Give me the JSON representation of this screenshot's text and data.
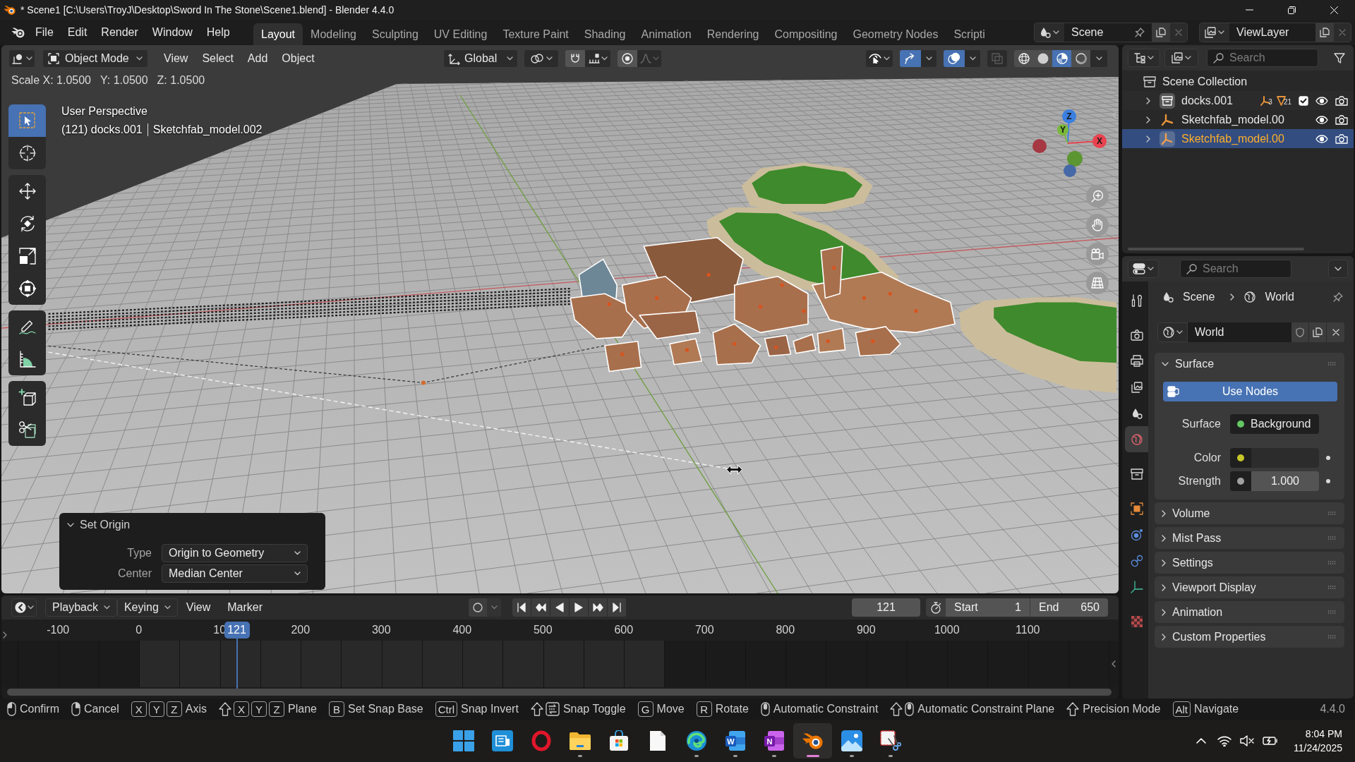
{
  "window": {
    "title": "* Scene1 [C:\\Users\\TroyJ\\Desktop\\Sword In The Stone\\Scene1.blend] - Blender 4.4.0"
  },
  "menu": [
    "File",
    "Edit",
    "Render",
    "Window",
    "Help"
  ],
  "workspaces": [
    {
      "label": "Layout",
      "selected": true
    },
    {
      "label": "Modeling",
      "selected": false
    },
    {
      "label": "Sculpting",
      "selected": false
    },
    {
      "label": "UV Editing",
      "selected": false
    },
    {
      "label": "Texture Paint",
      "selected": false
    },
    {
      "label": "Shading",
      "selected": false
    },
    {
      "label": "Animation",
      "selected": false
    },
    {
      "label": "Rendering",
      "selected": false
    },
    {
      "label": "Compositing",
      "selected": false
    },
    {
      "label": "Geometry Nodes",
      "selected": false
    },
    {
      "label": "Scripti",
      "selected": false
    }
  ],
  "scene_selector": {
    "value": "Scene"
  },
  "view_layer_selector": {
    "value": "ViewLayer"
  },
  "viewport": {
    "header": {
      "mode": "Object Mode",
      "menus": [
        "View",
        "Select",
        "Add",
        "Object"
      ],
      "orientation": "Global",
      "toggles": [
        {
          "kind": "gizmos",
          "on": true
        },
        {
          "kind": "overlays",
          "on": true
        },
        {
          "kind": "xray",
          "on": false
        }
      ],
      "shading": [
        {
          "kind": "wireframe",
          "selected": false
        },
        {
          "kind": "solid",
          "selected": false
        },
        {
          "kind": "material",
          "selected": true
        },
        {
          "kind": "rendered",
          "selected": false
        }
      ]
    },
    "readout": [
      "Scale X: 1.0500",
      "Y: 1.0500",
      "Z: 1.0500"
    ],
    "tool_groups": [
      [
        {
          "kind": "select_box",
          "selected": true
        },
        {
          "kind": "cursor",
          "selected": false
        }
      ],
      [
        {
          "kind": "move",
          "selected": false
        },
        {
          "kind": "rotate",
          "selected": false
        },
        {
          "kind": "scale",
          "selected": false
        },
        {
          "kind": "transform",
          "selected": false
        }
      ],
      [
        {
          "kind": "annotate",
          "selected": false
        },
        {
          "kind": "measure",
          "selected": false
        }
      ],
      [
        {
          "kind": "add_cube",
          "selected": false
        },
        {
          "kind": "cut",
          "selected": false
        }
      ]
    ],
    "view_name": "User Perspective",
    "object_info": [
      "(121) docks.001",
      "Sketchfab_model.002"
    ],
    "gizmo_axes": [
      {
        "label": "Z",
        "color": "#3b7fe0"
      },
      {
        "label": "Y",
        "color": "#7ab83a"
      },
      {
        "label": "X",
        "color": "#e8434f"
      }
    ],
    "last_operation": {
      "title": "Set Origin",
      "expanded": true,
      "fields": [
        {
          "label": "Type",
          "value": "Origin to Geometry"
        },
        {
          "label": "Center",
          "value": "Median Center"
        }
      ]
    }
  },
  "outliner": {
    "search": {
      "placeholder": "Search"
    },
    "tree": [
      {
        "label": "Scene Collection",
        "selected": false,
        "children": [
          {
            "kind": "collection",
            "label": "docks.001",
            "expanded": false,
            "selected": false,
            "counts": [
              "3",
              "21"
            ],
            "checked": true
          },
          {
            "kind": "armature",
            "label": "Sketchfab_model.00",
            "expanded": false,
            "selected": false
          },
          {
            "kind": "armature",
            "label": "Sketchfab_model.00",
            "expanded": false,
            "selected": true
          }
        ]
      }
    ]
  },
  "properties": {
    "search": {
      "placeholder": "Search"
    },
    "tab_groups": [
      [
        {
          "kind": "tool",
          "selected": false
        }
      ],
      [
        {
          "kind": "render",
          "selected": false
        },
        {
          "kind": "output",
          "selected": false
        },
        {
          "kind": "view_layer",
          "selected": false
        },
        {
          "kind": "scene",
          "selected": false
        },
        {
          "kind": "world",
          "selected": true
        }
      ],
      [
        {
          "kind": "collection",
          "selected": false
        }
      ],
      [
        {
          "kind": "object",
          "selected": false
        },
        {
          "kind": "physics",
          "selected": false
        },
        {
          "kind": "constraints",
          "selected": false
        },
        {
          "kind": "data",
          "selected": false
        }
      ],
      [
        {
          "kind": "texture",
          "selected": false
        }
      ]
    ],
    "breadcrumb": [
      "Scene",
      "World"
    ],
    "world_name": "World",
    "panels": [
      {
        "title": "Surface",
        "expanded": true,
        "use_nodes": "Use Nodes",
        "rows": [
          {
            "kind": "link",
            "label": "Surface",
            "value": "Background",
            "color": "#63c763"
          },
          {
            "kind": "color",
            "label": "Color",
            "color": "#c7c729"
          },
          {
            "kind": "number",
            "label": "Strength",
            "value": "1.000",
            "color": "#a1a1a1"
          }
        ]
      },
      {
        "title": "Volume",
        "expanded": false
      },
      {
        "title": "Mist Pass",
        "expanded": false
      },
      {
        "title": "Settings",
        "expanded": false
      },
      {
        "title": "Viewport Display",
        "expanded": false
      },
      {
        "title": "Animation",
        "expanded": false
      },
      {
        "title": "Custom Properties",
        "expanded": false
      }
    ]
  },
  "timeline": {
    "menus": [
      {
        "kind": "dropdown",
        "label": "Playback"
      },
      {
        "kind": "dropdown",
        "label": "Keying"
      },
      {
        "kind": "menu",
        "label": "View"
      },
      {
        "kind": "menu",
        "label": "Marker"
      }
    ],
    "auto_keying": false,
    "current_frame": "121",
    "start": {
      "label": "Start",
      "value": "1"
    },
    "end": {
      "label": "End",
      "value": "650"
    },
    "ruler": [
      "-100",
      "0",
      "10",
      "200",
      "300",
      "400",
      "500",
      "600",
      "700",
      "800",
      "900",
      "1000",
      "1100"
    ],
    "playhead": "121"
  },
  "status_bar": {
    "hints": [
      {
        "keys": [
          {
            "kind": "mouse_left"
          }
        ],
        "label": "Confirm"
      },
      {
        "keys": [
          {
            "kind": "mouse_right"
          }
        ],
        "label": "Cancel"
      },
      {
        "keys": [
          {
            "kind": "key",
            "label": "X"
          },
          {
            "kind": "key",
            "label": "Y"
          },
          {
            "kind": "key",
            "label": "Z"
          }
        ],
        "label": "Axis"
      },
      {
        "keys": [
          {
            "kind": "shift"
          },
          {
            "kind": "key",
            "label": "X"
          },
          {
            "kind": "key",
            "label": "Y"
          },
          {
            "kind": "key",
            "label": "Z"
          }
        ],
        "label": "Plane"
      },
      {
        "keys": [
          {
            "kind": "key",
            "label": "B"
          }
        ],
        "label": "Set Snap Base"
      },
      {
        "keys": [
          {
            "kind": "key",
            "label": "Ctrl"
          }
        ],
        "label": "Snap Invert"
      },
      {
        "keys": [
          {
            "kind": "shift"
          },
          {
            "kind": "snap"
          }
        ],
        "label": "Snap Toggle"
      },
      {
        "keys": [
          {
            "kind": "key",
            "label": "G"
          }
        ],
        "label": "Move"
      },
      {
        "keys": [
          {
            "kind": "key",
            "label": "R"
          }
        ],
        "label": "Rotate"
      },
      {
        "keys": [
          {
            "kind": "mouse_middle"
          }
        ],
        "label": "Automatic Constraint"
      },
      {
        "keys": [
          {
            "kind": "shift"
          },
          {
            "kind": "mouse_middle"
          }
        ],
        "label": "Automatic Constraint Plane"
      },
      {
        "keys": [
          {
            "kind": "shift"
          }
        ],
        "label": "Precision Mode"
      },
      {
        "keys": [
          {
            "kind": "key",
            "label": "Alt"
          }
        ],
        "label": "Navigate"
      }
    ],
    "version": "4.4.0"
  },
  "taskbar": {
    "apps": [
      {
        "kind": "start",
        "running": false,
        "selected": false
      },
      {
        "kind": "devices",
        "running": false,
        "selected": false
      },
      {
        "kind": "opera",
        "running": false,
        "selected": false
      },
      {
        "kind": "explorer",
        "running": true,
        "selected": false
      },
      {
        "kind": "store",
        "running": false,
        "selected": false
      },
      {
        "kind": "notepad",
        "running": false,
        "selected": false
      },
      {
        "kind": "edge",
        "running": true,
        "selected": false
      },
      {
        "kind": "word",
        "letter": "W",
        "running": true,
        "selected": false
      },
      {
        "kind": "onenote",
        "letter": "N",
        "running": true,
        "selected": false
      },
      {
        "kind": "blender",
        "running": true,
        "selected": true
      },
      {
        "kind": "photos",
        "running": true,
        "selected": false
      },
      {
        "kind": "snipping",
        "running": true,
        "selected": false
      }
    ],
    "time": "8:04 PM",
    "date": "11/24/2025"
  }
}
